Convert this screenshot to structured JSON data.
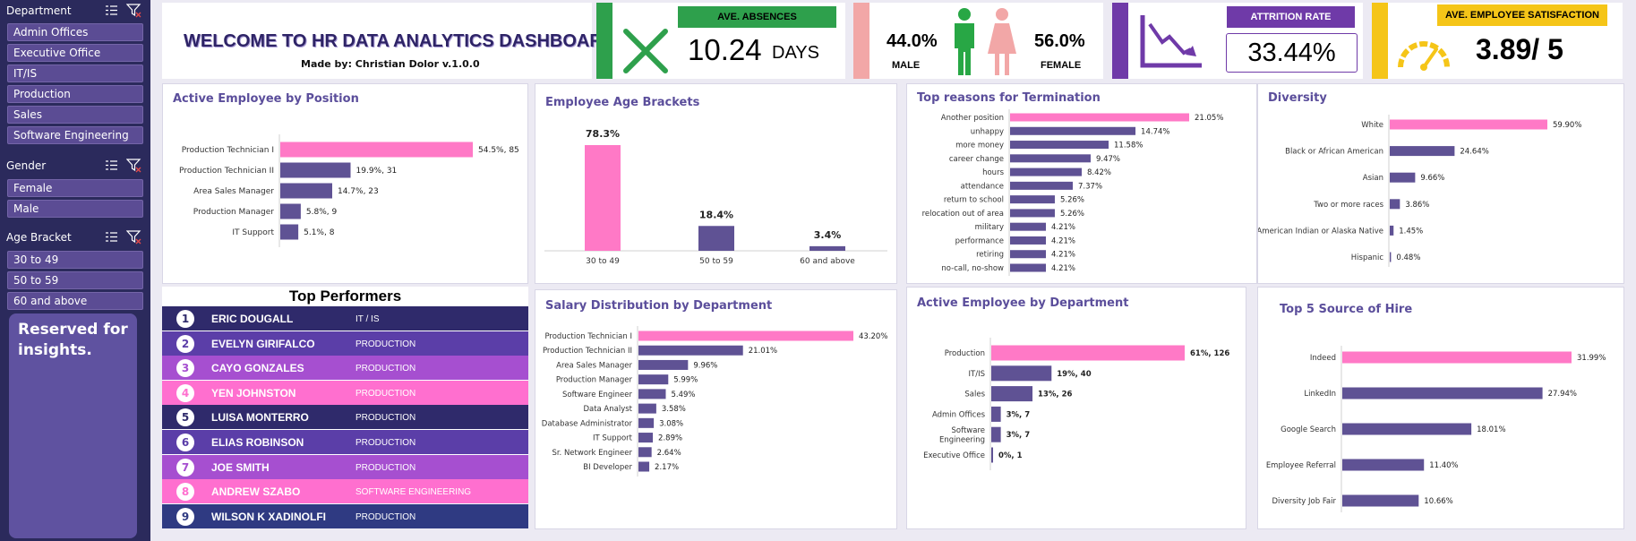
{
  "sidebar": {
    "slicers": [
      {
        "title": "Department",
        "items": [
          "Admin Offices",
          "Executive Office",
          "IT/IS",
          "Production",
          "Sales",
          "Software Engineering"
        ]
      },
      {
        "title": "Gender",
        "items": [
          "Female",
          "Male"
        ]
      },
      {
        "title": "Age Bracket",
        "items": [
          "30 to 49",
          "50 to 59",
          "60 and above"
        ]
      }
    ],
    "insights_text": "Reserved for insights."
  },
  "header": {
    "title": "WELCOME TO HR DATA ANALYTICS DASHBOARD",
    "subtitle": "Made by: Christian Dolor v.1.0.0"
  },
  "kpis": {
    "absences": {
      "label": "AVE. ABSENCES",
      "value": "10.24",
      "unit": "DAYS",
      "color": "#2ea04c"
    },
    "gender": {
      "male_pct": "44.0%",
      "male_label": "MALE",
      "female_pct": "56.0%",
      "female_label": "FEMALE",
      "male_color": "#28a745",
      "female_color": "#f2a7a7"
    },
    "attrition": {
      "label": "ATTRITION RATE",
      "value": "33.44%",
      "color": "#6f3aa8"
    },
    "satisfaction": {
      "label": "AVE. EMPLOYEE SATISFACTION",
      "value": "3.89/ 5",
      "color": "#f5c518"
    }
  },
  "colors": {
    "highlight": "#ff79c6",
    "bar": "#5f5294",
    "title": "#5b4e9b"
  },
  "chart_data": [
    {
      "id": "position",
      "type": "bar",
      "orientation": "horizontal",
      "title": "Active Employee by Position",
      "categories": [
        "Production Technician I",
        "Production Technician II",
        "Area Sales Manager",
        "Production Manager",
        "IT Support"
      ],
      "values": [
        54.5,
        19.9,
        14.7,
        5.8,
        5.1
      ],
      "labels": [
        "54.5%, 85",
        "19.9%, 31",
        "14.7%, 23",
        "5.8%, 9",
        "5.1%, 8"
      ]
    },
    {
      "id": "age",
      "type": "bar",
      "orientation": "vertical",
      "title": "Employee Age Brackets",
      "categories": [
        "30 to 49",
        "50 to 59",
        "60 and above"
      ],
      "values": [
        78.3,
        18.4,
        3.4
      ],
      "labels": [
        "78.3%",
        "18.4%",
        "3.4%"
      ]
    },
    {
      "id": "termination",
      "type": "bar",
      "orientation": "horizontal",
      "title": "Top reasons for Termination",
      "categories": [
        "Another position",
        "unhappy",
        "more money",
        "career change",
        "hours",
        "attendance",
        "return to school",
        "relocation out of area",
        "military",
        "performance",
        "retiring",
        "no-call, no-show"
      ],
      "values": [
        21.05,
        14.74,
        11.58,
        9.47,
        8.42,
        7.37,
        5.26,
        5.26,
        4.21,
        4.21,
        4.21,
        4.21
      ],
      "labels": [
        "21.05%",
        "14.74%",
        "11.58%",
        "9.47%",
        "8.42%",
        "7.37%",
        "5.26%",
        "5.26%",
        "4.21%",
        "4.21%",
        "4.21%",
        "4.21%"
      ]
    },
    {
      "id": "diversity",
      "type": "bar",
      "orientation": "horizontal",
      "title": "Diversity",
      "categories": [
        "White",
        "Black or African American",
        "Asian",
        "Two or more races",
        "American Indian or Alaska Native",
        "Hispanic"
      ],
      "values": [
        59.9,
        24.64,
        9.66,
        3.86,
        1.45,
        0.48
      ],
      "labels": [
        "59.90%",
        "24.64%",
        "9.66%",
        "3.86%",
        "1.45%",
        "0.48%"
      ]
    },
    {
      "id": "salary",
      "type": "bar",
      "orientation": "horizontal",
      "title": "Salary Distribution by Department",
      "categories": [
        "Production Technician I",
        "Production Technician II",
        "Area Sales Manager",
        "Production Manager",
        "Software Engineer",
        "Data Analyst",
        "Database Administrator",
        "IT Support",
        "Sr. Network Engineer",
        "BI Developer"
      ],
      "values": [
        43.2,
        21.01,
        9.96,
        5.99,
        5.49,
        3.58,
        3.08,
        2.89,
        2.64,
        2.17
      ],
      "labels": [
        "43.20%",
        "21.01%",
        "9.96%",
        "5.99%",
        "5.49%",
        "3.58%",
        "3.08%",
        "2.89%",
        "2.64%",
        "2.17%"
      ]
    },
    {
      "id": "department",
      "type": "bar",
      "orientation": "horizontal",
      "title": "Active Employee by Department",
      "categories": [
        "Production",
        "IT/IS",
        "Sales",
        "Admin Offices",
        "Software Engineering",
        "Executive Office"
      ],
      "values": [
        61,
        19,
        13,
        3,
        3,
        0
      ],
      "labels": [
        "61%, 126",
        "19%, 40",
        "13%, 26",
        "3%, 7",
        "3%, 7",
        "0%, 1"
      ]
    },
    {
      "id": "hire",
      "type": "bar",
      "orientation": "horizontal",
      "title": "Top 5 Source of Hire",
      "categories": [
        "Indeed",
        "LinkedIn",
        "Google Search",
        "Employee Referral",
        "Diversity Job Fair"
      ],
      "values": [
        31.99,
        27.94,
        18.01,
        11.4,
        10.66
      ],
      "labels": [
        "31.99%",
        "27.94%",
        "18.01%",
        "11.40%",
        "10.66%"
      ]
    }
  ],
  "top_performers": {
    "title": "Top Performers",
    "rows": [
      {
        "rank": "1",
        "name": "ERIC DOUGALL",
        "dept": "IT / IS",
        "color": "#2f2a6b"
      },
      {
        "rank": "2",
        "name": "EVELYN GIRIFALCO",
        "dept": "PRODUCTION",
        "color": "#5b3ea8"
      },
      {
        "rank": "3",
        "name": "CAYO GONZALES",
        "dept": "PRODUCTION",
        "color": "#a64fd0"
      },
      {
        "rank": "4",
        "name": "YEN JOHNSTON",
        "dept": "PRODUCTION",
        "color": "#ff6fcf"
      },
      {
        "rank": "5",
        "name": "LUISA MONTERRO",
        "dept": "PRODUCTION",
        "color": "#2f2a6b"
      },
      {
        "rank": "6",
        "name": "ELIAS ROBINSON",
        "dept": "PRODUCTION",
        "color": "#5b3ea8"
      },
      {
        "rank": "7",
        "name": "JOE SMITH",
        "dept": "PRODUCTION",
        "color": "#a64fd0"
      },
      {
        "rank": "8",
        "name": "ANDREW SZABO",
        "dept": "SOFTWARE ENGINEERING",
        "color": "#ff6fcf"
      },
      {
        "rank": "9",
        "name": "WILSON K XADINOLFI",
        "dept": "PRODUCTION",
        "color": "#2f3a82"
      }
    ]
  }
}
